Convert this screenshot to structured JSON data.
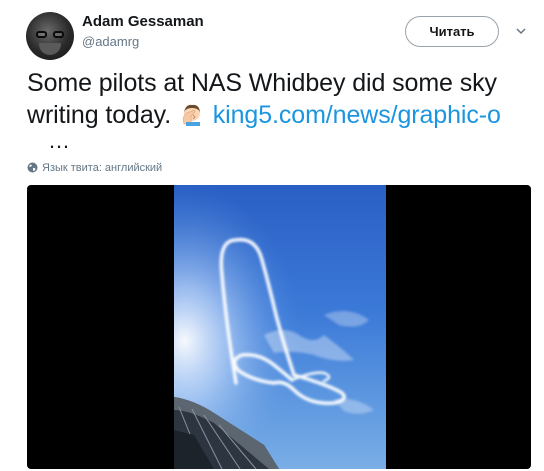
{
  "author": {
    "name": "Adam Gessaman",
    "handle": "@adamrg"
  },
  "follow_button_label": "Читать",
  "tweet": {
    "line1": "Some pilots at NAS Whidbey did some sky",
    "line2_text": "writing today.",
    "emoji": "facepalm-emoji",
    "link": "king5.com/news/graphic-o",
    "ellipsis": "…"
  },
  "language_note": "Язык твита: английский",
  "colors": {
    "link": "#1b95e0",
    "secondary_text": "#657786",
    "text": "#14171a"
  },
  "media": {
    "description_icon": "sky-writing-photo"
  }
}
